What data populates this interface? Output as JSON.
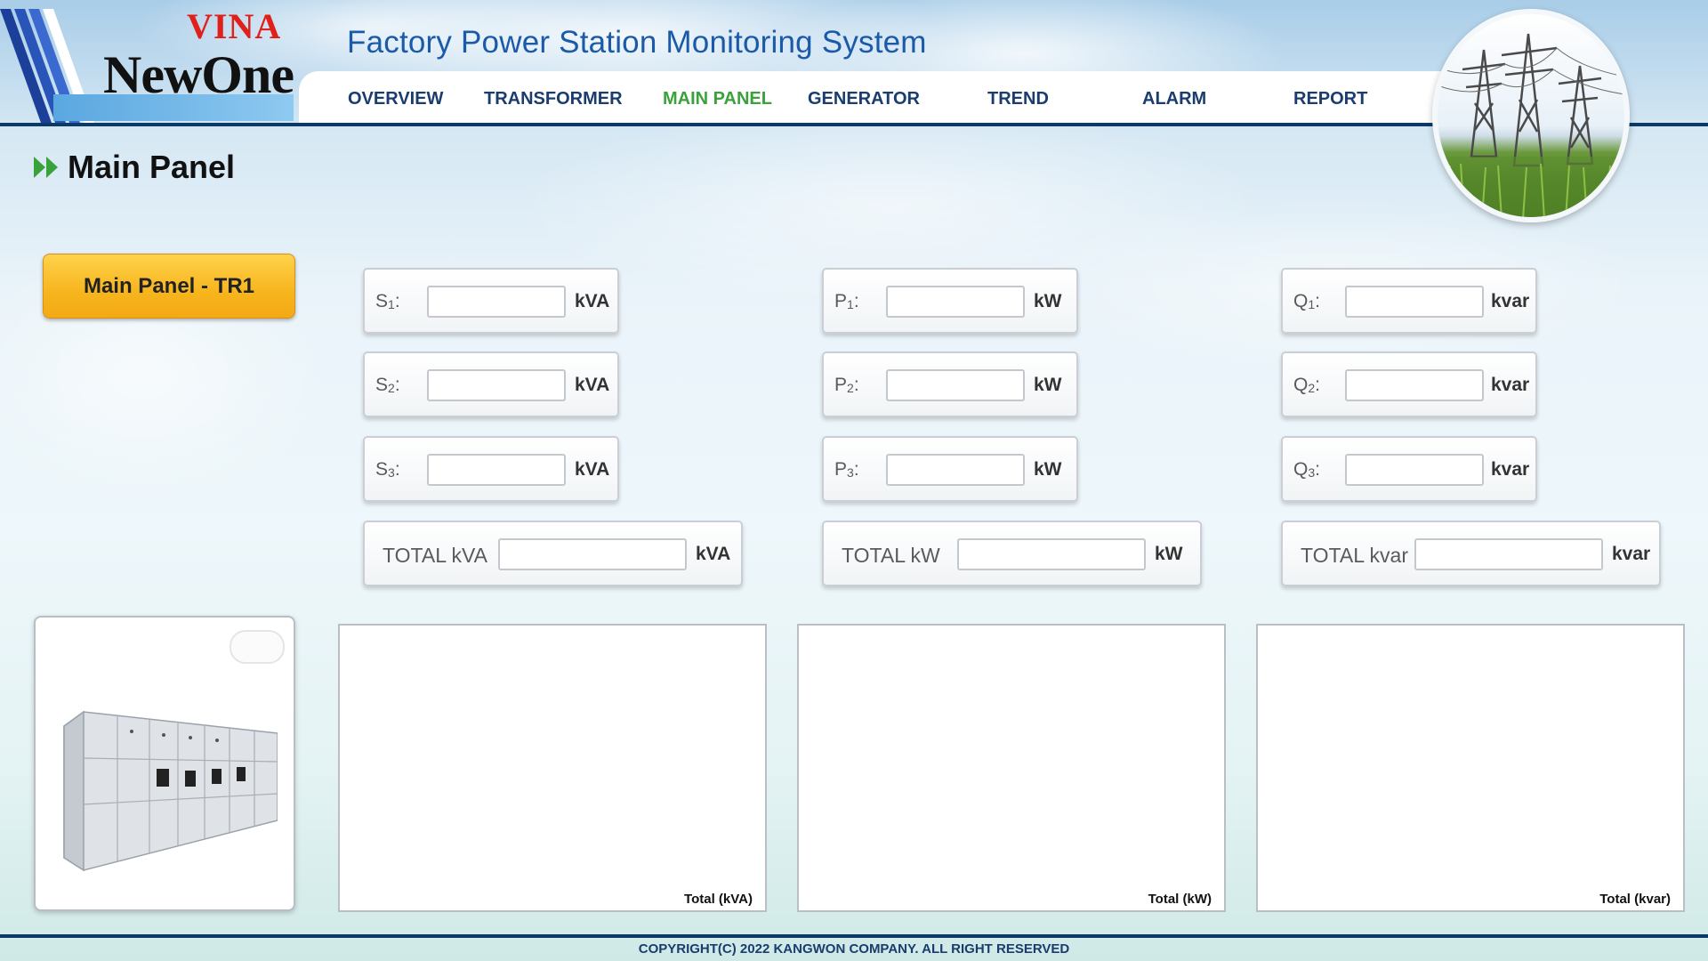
{
  "logo": {
    "brand_top": "VINA",
    "brand_main": "NewOne"
  },
  "app_title": "Factory Power Station Monitoring System",
  "nav": {
    "items": [
      "OVERVIEW",
      "TRANSFORMER",
      "MAIN PANEL",
      "GENERATOR",
      "TREND",
      "ALARM",
      "REPORT"
    ],
    "active": "MAIN PANEL"
  },
  "colors": {
    "nav_text": "#1a3c6e",
    "nav_active": "#3aa23a",
    "header_line": "#0c3a66",
    "panel_button": "#f7b51d",
    "title": "#1b5aa8"
  },
  "page_title": "Main Panel",
  "panel_button": "Main Panel - TR1",
  "apparent": {
    "rows": [
      {
        "label": "S",
        "sub": "1",
        "unit": "kVA",
        "value": ""
      },
      {
        "label": "S",
        "sub": "2",
        "unit": "kVA",
        "value": ""
      },
      {
        "label": "S",
        "sub": "3",
        "unit": "kVA",
        "value": ""
      }
    ],
    "total_label": "TOTAL kVA",
    "total_unit": "kVA",
    "total_value": ""
  },
  "active_power": {
    "rows": [
      {
        "label": "P",
        "sub": "1",
        "unit": "kW",
        "value": ""
      },
      {
        "label": "P",
        "sub": "2",
        "unit": "kW",
        "value": ""
      },
      {
        "label": "P",
        "sub": "3",
        "unit": "kW",
        "value": ""
      }
    ],
    "total_label": "TOTAL kW",
    "total_unit": "kW",
    "total_value": ""
  },
  "reactive_power": {
    "rows": [
      {
        "label": "Q",
        "sub": "1",
        "unit": "kvar",
        "value": ""
      },
      {
        "label": "Q",
        "sub": "2",
        "unit": "kvar",
        "value": ""
      },
      {
        "label": "Q",
        "sub": "3",
        "unit": "kvar",
        "value": ""
      }
    ],
    "total_label": "TOTAL kvar",
    "total_unit": "kvar",
    "total_value": ""
  },
  "charts": {
    "kva_label": "Total (kVA)",
    "kw_label": "Total (kW)",
    "kvar_label": "Total (kvar)"
  },
  "icons": {
    "heading": "double-arrow-icon",
    "tower": "power-tower-icon",
    "panel": "switchgear-cabinet-icon"
  },
  "footer": "COPYRIGHT(C) 2022 KANGWON COMPANY. ALL RIGHT RESERVED"
}
